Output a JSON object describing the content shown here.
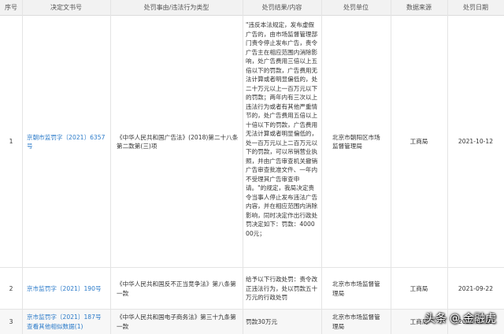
{
  "table": {
    "columns": [
      "序号",
      "决定文书号",
      "处罚事由/违法行为类型",
      "处罚结果/内容",
      "处罚单位",
      "数据来源",
      "处罚日期"
    ],
    "rows": [
      {
        "index": "1",
        "doc_no": "京朝市监罚字〔2021〕6357号",
        "reason": "《中华人民共和国广告法》(2018)第二十八条第二款第(三)项",
        "result": "\"违反本法规定，发布虚假广告的，由市场监督管理部门责令停止发布广告，责令广告主在相应范围内消除影响，处广告费用三倍以上五倍以下的罚款，广告费用无法计算或者明显偏低的，处二十万元以上一百万元以下的罚款；两年内有三次以上违法行为或者有其他严重情节的，处广告费用五倍以上十倍以下的罚款，广告费用无法计算或者明显偏低的，处一百万元以上二百万元以下的罚款，可以吊销营业执照，并由广告审查机关撤销广告审查批准文件、一年内不受理其广告审查申请。\"的规定，我局决定责令当事人停止发布违法广告内容，并在相应范围内消除影响，同时决定作出行政处罚决定如下：罚款：400000元；",
        "unit": "北京市朝阳区市场监督管理局",
        "source": "工商局",
        "date": "2021-10-12"
      },
      {
        "index": "2",
        "doc_no": "京市监罚字〔2021〕190号",
        "reason": "《中华人民共和国反不正当竞争法》第八条第一款",
        "result": "给予以下行政处罚：责令改正违法行为，处以罚款五十万元的行政处罚",
        "unit": "北京市市场监督管理局",
        "source": "工商局",
        "date": "2021-09-22"
      },
      {
        "index": "3",
        "doc_no": "京市监罚字〔2021〕187号",
        "doc_extra": "查看其他相似数据(1)",
        "reason": "《中华人民共和国电子商务法》第三十九条第一款",
        "result": "罚款30万元",
        "unit": "北京市市场监督管理局",
        "source": "工商局",
        "date": "2021-09-22"
      }
    ]
  },
  "watermark": {
    "brand": "头条",
    "at": "@",
    "account": "金融虎"
  }
}
